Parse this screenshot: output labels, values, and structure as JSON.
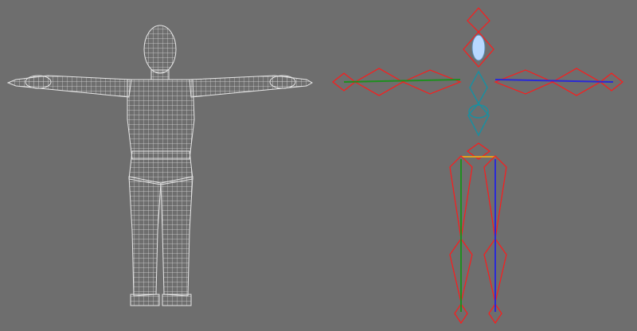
{
  "viewport": {
    "background": "#6e6e6e",
    "left_object": "wireframe-character-mesh",
    "right_object": "biped-skeleton-rig"
  },
  "colors": {
    "wire": "#dcdcdc",
    "bone_outline": "#ff1a1a",
    "left_limb": "#1f8f1f",
    "right_limb": "#2a2ad6",
    "spine": "#1a8fa0",
    "head_fill": "#b8d8ff",
    "pelvis": "#e0a020"
  }
}
